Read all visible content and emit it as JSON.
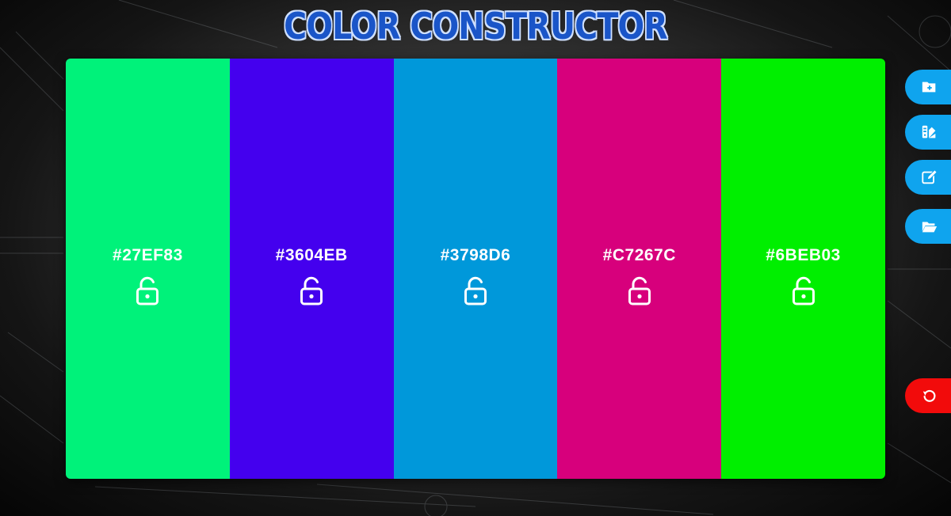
{
  "app": {
    "title": "COLOR CONSTRUCTOR"
  },
  "palette": {
    "swatches": [
      {
        "hex": "#27EF83",
        "color": "#00f27a",
        "locked": false,
        "lock_icon": "unlocked-icon"
      },
      {
        "hex": "#3604EB",
        "color": "#4400ee",
        "locked": false,
        "lock_icon": "unlocked-icon"
      },
      {
        "hex": "#3798D6",
        "color": "#0098da",
        "locked": false,
        "lock_icon": "unlocked-icon"
      },
      {
        "hex": "#C7267C",
        "color": "#d7007c",
        "locked": false,
        "lock_icon": "unlocked-icon"
      },
      {
        "hex": "#6BEB03",
        "color": "#00ef00",
        "locked": false,
        "lock_icon": "unlocked-icon"
      }
    ]
  },
  "sidebar": {
    "buttons": [
      {
        "name": "new-folder-button",
        "icon": "folder-plus-icon",
        "color": "#0fa4ee"
      },
      {
        "name": "palette-library-button",
        "icon": "swatchbook-icon",
        "color": "#0fa4ee"
      },
      {
        "name": "edit-button",
        "icon": "edit-icon",
        "color": "#0fa4ee"
      },
      {
        "name": "open-folder-button",
        "icon": "folder-open-icon",
        "color": "#0fa4ee"
      },
      {
        "name": "reset-button",
        "icon": "undo-icon",
        "color": "#f20b0b"
      }
    ]
  }
}
